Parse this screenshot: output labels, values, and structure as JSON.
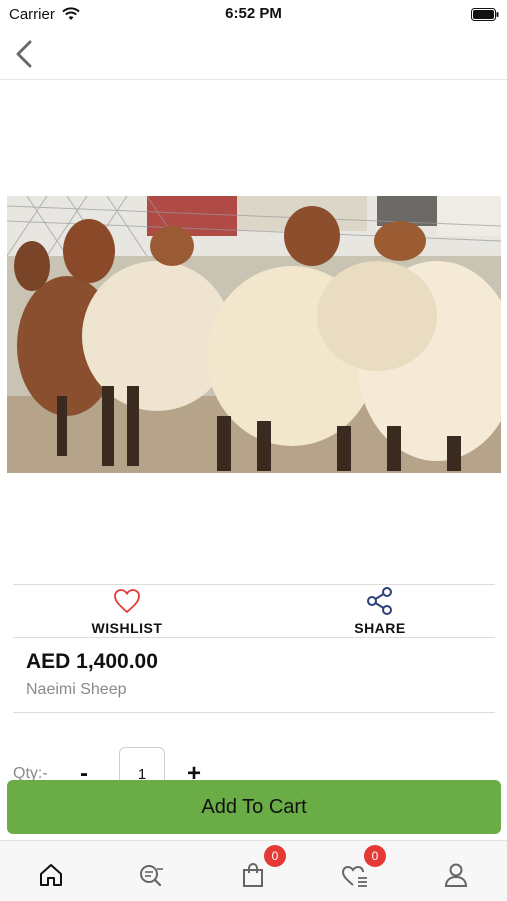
{
  "status_bar": {
    "carrier": "Carrier",
    "time": "6:52 PM"
  },
  "nav": {
    "back_icon": "chevron-left-icon"
  },
  "product": {
    "price": "AED 1,400.00",
    "name": "Naeimi Sheep",
    "image": "photo of sheep in a pen"
  },
  "actions": {
    "wishlist_label": "WISHLIST",
    "share_label": "SHARE"
  },
  "quantity": {
    "label": "Qty:-",
    "minus": "-",
    "value": "1",
    "plus": "+"
  },
  "add_to_cart_label": "Add To Cart",
  "tabs": {
    "home_icon": "home-icon",
    "search_icon": "search-icon",
    "cart_icon": "shopping-bag-icon",
    "cart_badge": "0",
    "wishlist_icon": "heart-list-icon",
    "wishlist_badge": "0",
    "profile_icon": "user-icon"
  },
  "colors": {
    "accent_green": "#6aad46",
    "heart_red": "#e53935",
    "share_blue": "#2b3f7a"
  }
}
